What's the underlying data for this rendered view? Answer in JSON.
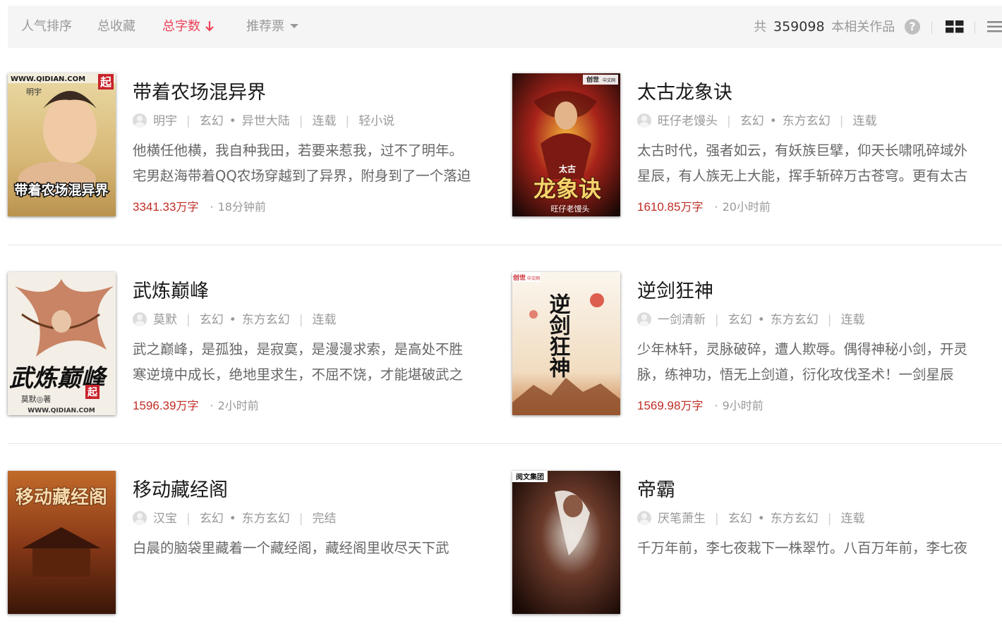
{
  "sort_bar": {
    "tabs": [
      {
        "label": "人气排序",
        "active": false
      },
      {
        "label": "总收藏",
        "active": false
      },
      {
        "label": "总字数",
        "active": true
      },
      {
        "label": "推荐票",
        "active": false
      }
    ],
    "total_prefix": "共",
    "total_count": "359098",
    "total_suffix": "本相关作品",
    "help_icon": "?"
  },
  "colors": {
    "accent": "#ed4259",
    "word_count": "#bf2c24",
    "sort_bg": "#f5f5f5"
  },
  "books": [
    {
      "title": "带着农场混异界",
      "author": "明宇",
      "category": "玄幻",
      "subcategory": "异世大陆",
      "status": "连载",
      "tag": "轻小说",
      "intro_1": "他横任他横，我自种我田，若要来惹我，过不了明年。",
      "intro_2": "宅男赵海带着QQ农场穿越到了异界，附身到了一个落迫",
      "words": "3341.33",
      "words_unit": "万字",
      "updated": "18分钟前",
      "cover_text": {
        "site": "WWW.QIDIAN.COM",
        "brand": "起",
        "author": "明宇",
        "title": "带着农场混异界"
      }
    },
    {
      "title": "太古龙象诀",
      "author": "旺仔老馒头",
      "category": "玄幻",
      "subcategory": "东方玄幻",
      "status": "连载",
      "intro_1": "太古时代，强者如云，有妖族巨擘，仰天长啸吼碎域外",
      "intro_2": "星辰，有人族无上大能，挥手斩碎万古苍穹。更有太古",
      "words": "1610.85",
      "words_unit": "万字",
      "updated": "20小时前",
      "cover_text": {
        "brand": "创世",
        "brand_sub": "中文网",
        "top": "太古",
        "title": "龙象诀",
        "author": "旺仔老馒头"
      }
    },
    {
      "title": "武炼巅峰",
      "author": "莫默",
      "category": "玄幻",
      "subcategory": "东方玄幻",
      "status": "连载",
      "intro_1": "武之巅峰，是孤独，是寂寞，是漫漫求索，是高处不胜",
      "intro_2": "寒逆境中成长，绝地里求生，不屈不饶，才能堪破武之",
      "words": "1596.39",
      "words_unit": "万字",
      "updated": "2小时前",
      "cover_text": {
        "title": "武炼巅峰",
        "brand": "起",
        "author": "莫默◎著",
        "site": "WWW.QIDIAN.COM"
      }
    },
    {
      "title": "逆剑狂神",
      "author": "一剑清新",
      "category": "玄幻",
      "subcategory": "东方玄幻",
      "status": "连载",
      "intro_1": "少年林轩，灵脉破碎，遭人欺辱。偶得神秘小剑，开灵",
      "intro_2": "脉，练神功，悟无上剑道，衍化攻伐圣术！一剑星辰",
      "words": "1569.98",
      "words_unit": "万字",
      "updated": "9小时前",
      "cover_text": {
        "brand": "创世",
        "brand_sub": "中文网",
        "title": "逆剑狂神"
      }
    },
    {
      "title": "移动藏经阁",
      "author": "汉宝",
      "category": "玄幻",
      "subcategory": "东方玄幻",
      "status": "完结",
      "intro_1": "白晨的脑袋里藏着一个藏经阁，藏经阁里收尽天下武",
      "intro_2": "",
      "words": "",
      "words_unit": "",
      "updated": "",
      "cover_text": {
        "title": "移动藏经阁"
      }
    },
    {
      "title": "帝霸",
      "author": "厌笔萧生",
      "category": "玄幻",
      "subcategory": "东方玄幻",
      "status": "连载",
      "intro_1": "千万年前，李七夜栽下一株翠竹。八百万年前，李七夜",
      "intro_2": "",
      "words": "",
      "words_unit": "",
      "updated": "",
      "cover_text": {
        "brand": "阅文集团"
      }
    }
  ]
}
